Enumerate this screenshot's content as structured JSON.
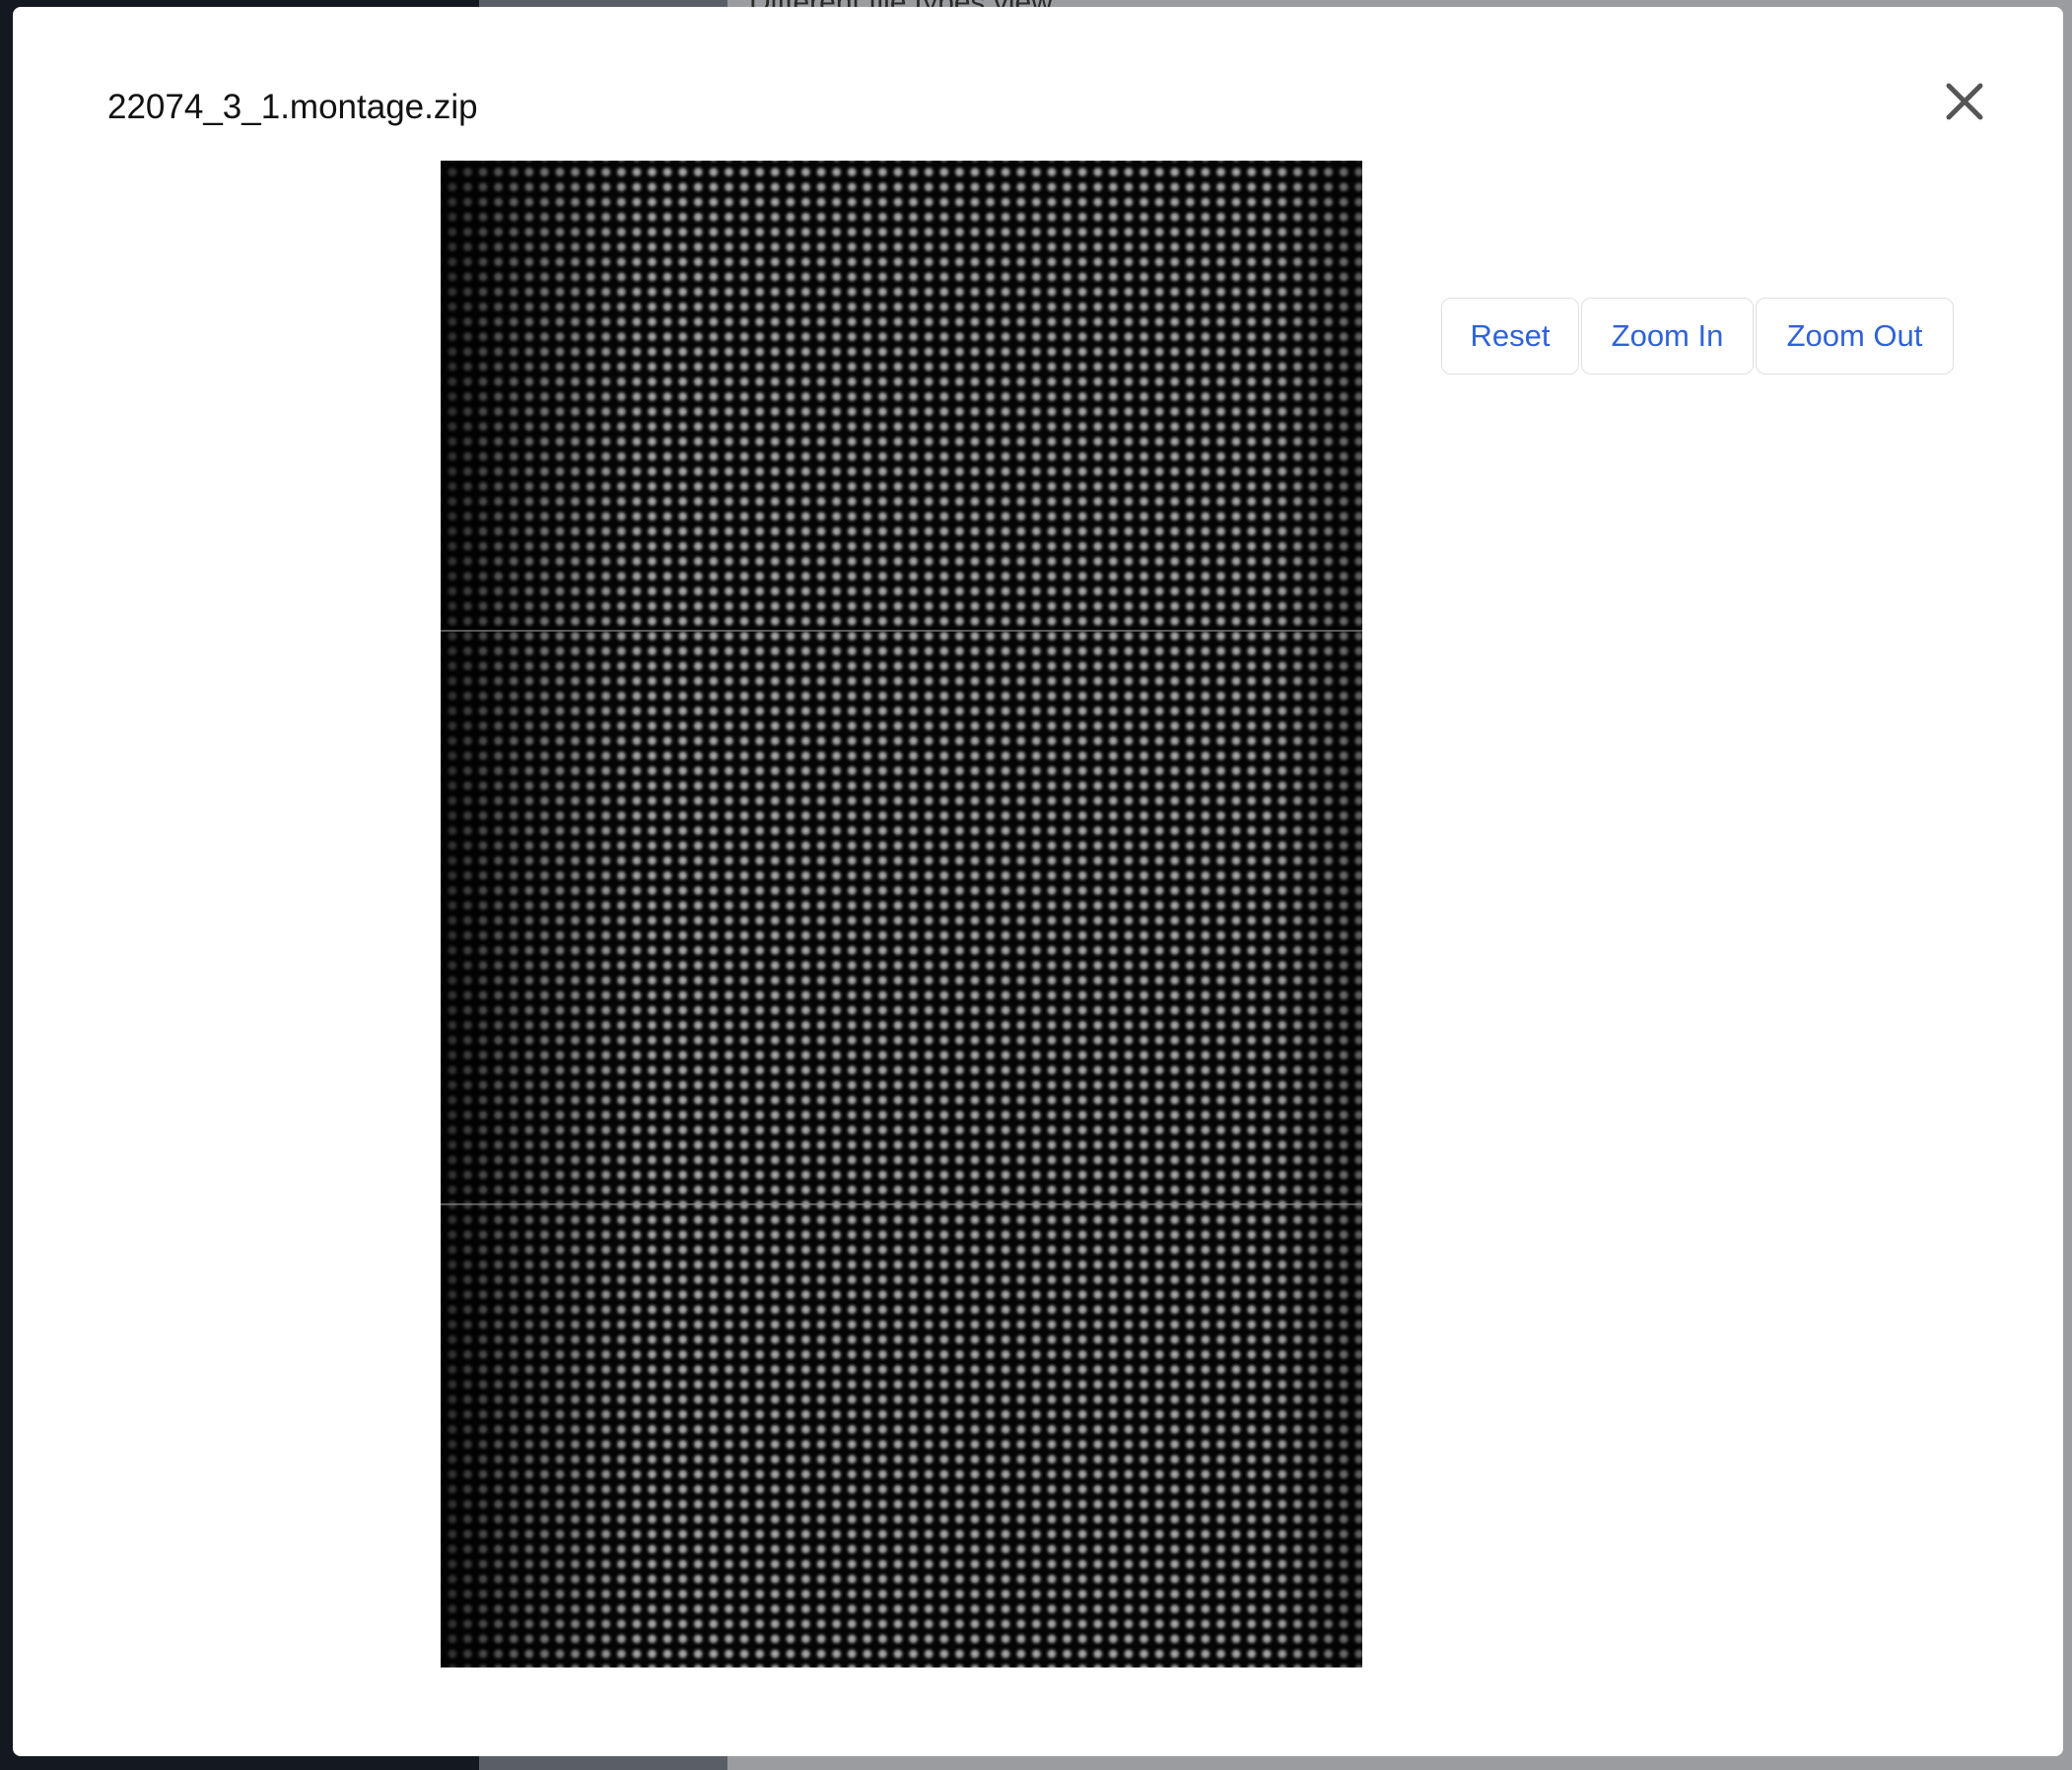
{
  "background": {
    "partial_text": "Different file types view"
  },
  "modal": {
    "title": "22074_3_1.montage.zip",
    "close_icon": "close-icon",
    "image_alt": "montage image"
  },
  "controls": {
    "reset_label": "Reset",
    "zoom_in_label": "Zoom In",
    "zoom_out_label": "Zoom Out",
    "accent_color": "#2f63d6"
  }
}
